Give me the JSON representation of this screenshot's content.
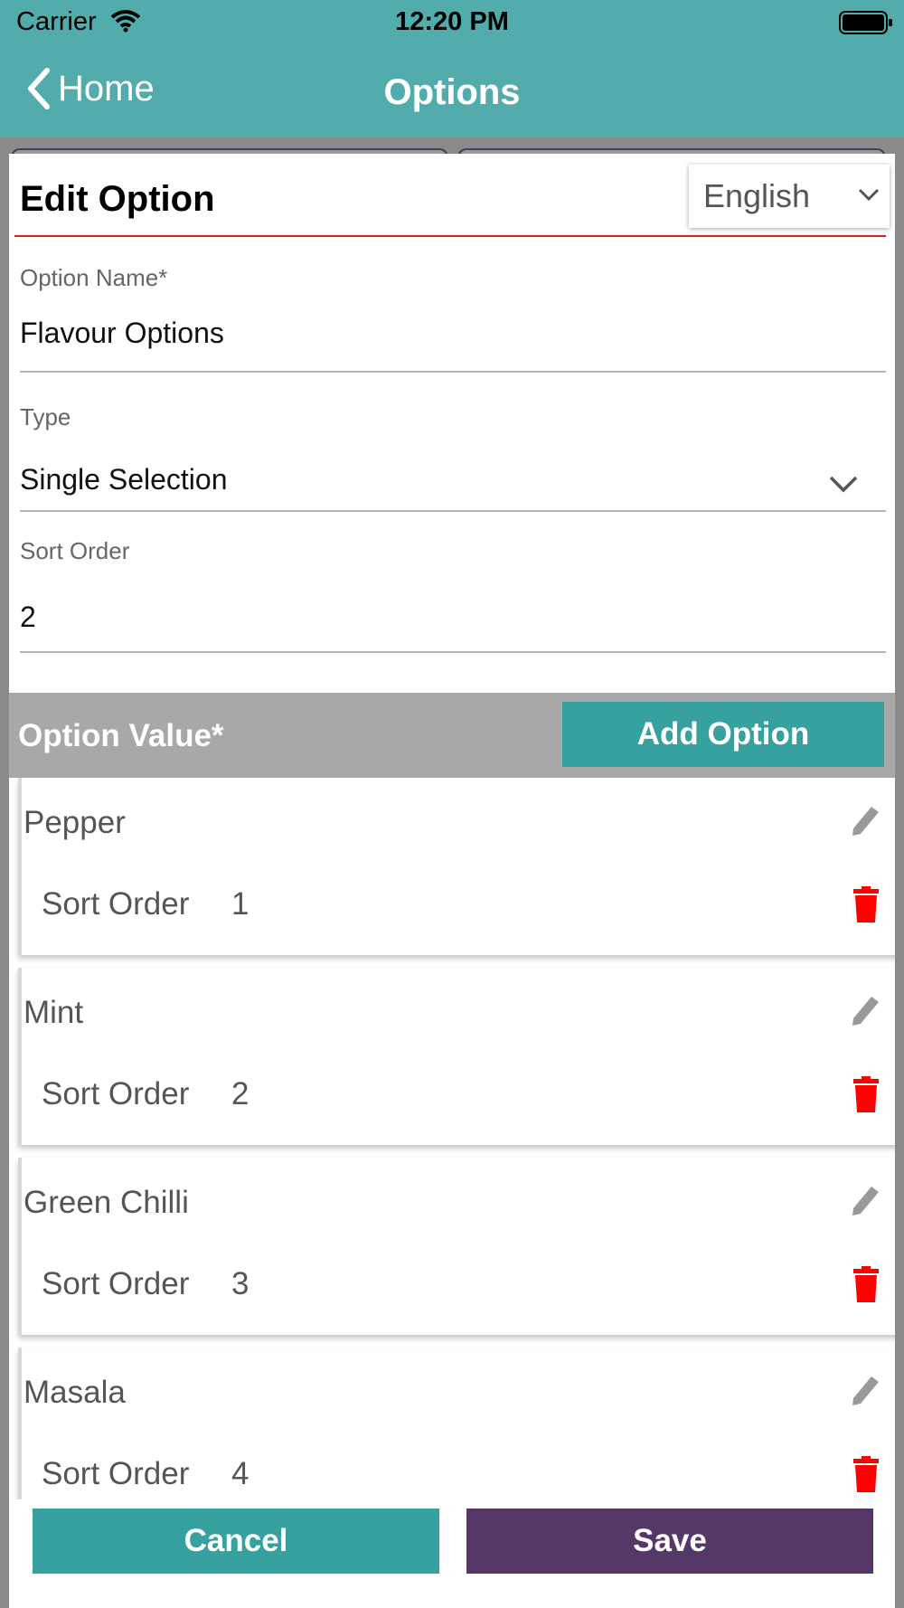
{
  "status_bar": {
    "carrier": "Carrier",
    "time": "12:20 PM"
  },
  "nav": {
    "back_label": "Home",
    "title": "Options"
  },
  "form": {
    "title": "Edit Option",
    "language": "English",
    "option_name": {
      "label": "Option Name*",
      "value": "Flavour Options"
    },
    "type": {
      "label": "Type",
      "value": "Single Selection"
    },
    "sort_order": {
      "label": "Sort Order",
      "value": "2"
    }
  },
  "option_values": {
    "label": "Option Value*",
    "add_button": "Add Option",
    "sort_label": "Sort Order",
    "items": [
      {
        "name": "Pepper",
        "sort": "1"
      },
      {
        "name": "Mint",
        "sort": "2"
      },
      {
        "name": "Green Chilli",
        "sort": "3"
      },
      {
        "name": "Masala",
        "sort": "4"
      }
    ]
  },
  "footer": {
    "cancel": "Cancel",
    "save": "Save"
  },
  "colors": {
    "teal": "#52acac",
    "button_teal": "#36a19e",
    "purple": "#563868",
    "delete_red": "#ff0000",
    "divider_red": "#d32020"
  }
}
